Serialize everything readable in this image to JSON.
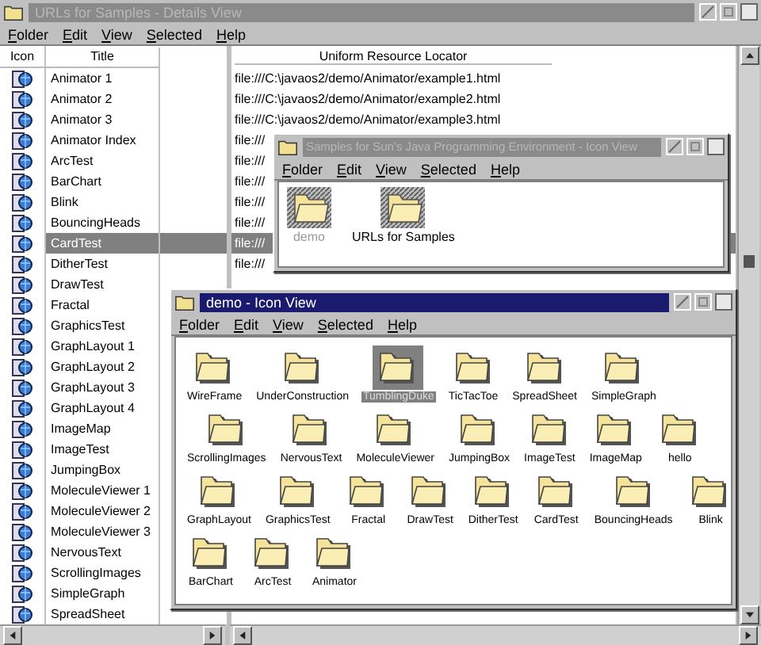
{
  "main_window": {
    "title": "URLs for Samples - Details View",
    "active": false,
    "menu": [
      "Folder",
      "Edit",
      "View",
      "Selected",
      "Help"
    ],
    "columns": [
      "Icon",
      "Title",
      "Uniform Resource Locator"
    ],
    "rows": [
      {
        "title": "Animator 1",
        "url": "file:///C:\\javaos2/demo/Animator/example1.html",
        "selected": false
      },
      {
        "title": "Animator 2",
        "url": "file:///C:\\javaos2/demo/Animator/example2.html",
        "selected": false
      },
      {
        "title": "Animator 3",
        "url": "file:///C:\\javaos2/demo/Animator/example3.html",
        "selected": false
      },
      {
        "title": "Animator Index",
        "url": "file:///",
        "selected": false
      },
      {
        "title": "ArcTest",
        "url": "file:///",
        "selected": false
      },
      {
        "title": "BarChart",
        "url": "file:///",
        "selected": false
      },
      {
        "title": "Blink",
        "url": "file:///",
        "selected": false
      },
      {
        "title": "BouncingHeads",
        "url": "file:///",
        "selected": false
      },
      {
        "title": "CardTest",
        "url": "file:///",
        "selected": true
      },
      {
        "title": "DitherTest",
        "url": "file:///",
        "selected": false
      },
      {
        "title": "DrawTest",
        "selected": false
      },
      {
        "title": "Fractal",
        "selected": false
      },
      {
        "title": "GraphicsTest",
        "selected": false
      },
      {
        "title": "GraphLayout 1",
        "selected": false
      },
      {
        "title": "GraphLayout 2",
        "selected": false
      },
      {
        "title": "GraphLayout 3",
        "selected": false
      },
      {
        "title": "GraphLayout 4",
        "selected": false
      },
      {
        "title": "ImageMap",
        "selected": false
      },
      {
        "title": "ImageTest",
        "selected": false
      },
      {
        "title": "JumpingBox",
        "selected": false
      },
      {
        "title": "MoleculeViewer 1",
        "selected": false
      },
      {
        "title": "MoleculeViewer 2",
        "selected": false
      },
      {
        "title": "MoleculeViewer 3",
        "selected": false
      },
      {
        "title": "NervousText",
        "selected": false
      },
      {
        "title": "ScrollingImages",
        "selected": false
      },
      {
        "title": "SimpleGraph",
        "selected": false
      },
      {
        "title": "SpreadSheet",
        "selected": false
      }
    ]
  },
  "samples_window": {
    "title": "Samples for Sun's Java Programming Environment - Icon View",
    "active": false,
    "menu": [
      "Folder",
      "Edit",
      "View",
      "Selected",
      "Help"
    ],
    "icons": [
      {
        "label": "demo",
        "dimmed": true
      },
      {
        "label": "URLs for Samples",
        "dimmed": false
      }
    ]
  },
  "demo_window": {
    "title": "demo - Icon View",
    "active": true,
    "menu": [
      "Folder",
      "Edit",
      "View",
      "Selected",
      "Help"
    ],
    "icon_rows": [
      [
        {
          "label": "WireFrame",
          "selected": false
        },
        {
          "label": "UnderConstruction",
          "selected": false
        },
        {
          "label": "TumblingDuke",
          "selected": true
        },
        {
          "label": "TicTacToe",
          "selected": false
        },
        {
          "label": "SpreadSheet",
          "selected": false
        },
        {
          "label": "SimpleGraph",
          "selected": false
        }
      ],
      [
        {
          "label": "ScrollingImages",
          "selected": false
        },
        {
          "label": "NervousText",
          "selected": false
        },
        {
          "label": "MoleculeViewer",
          "selected": false
        },
        {
          "label": "JumpingBox",
          "selected": false
        },
        {
          "label": "ImageTest",
          "selected": false
        },
        {
          "label": "ImageMap",
          "selected": false
        },
        {
          "label": "hello",
          "selected": false
        }
      ],
      [
        {
          "label": "GraphLayout",
          "selected": false
        },
        {
          "label": "GraphicsTest",
          "selected": false
        },
        {
          "label": "Fractal",
          "selected": false
        },
        {
          "label": "DrawTest",
          "selected": false
        },
        {
          "label": "DitherTest",
          "selected": false
        },
        {
          "label": "CardTest",
          "selected": false
        },
        {
          "label": "BouncingHeads",
          "selected": false
        },
        {
          "label": "Blink",
          "selected": false
        }
      ],
      [
        {
          "label": "BarChart",
          "selected": false
        },
        {
          "label": "ArcTest",
          "selected": false
        },
        {
          "label": "Animator",
          "selected": false
        }
      ]
    ]
  }
}
